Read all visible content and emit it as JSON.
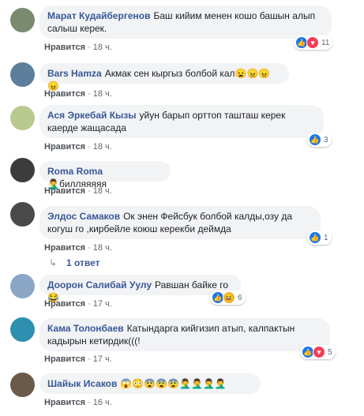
{
  "like_label": "Нравится",
  "dot": "·",
  "comments": [
    {
      "author": "Марат Кудайбергенов",
      "text": "Баш кийим менен кошо башын алып салыш керек.",
      "time": "18 ч.",
      "reactions": {
        "icons": [
          "like-icon",
          "love-icon"
        ],
        "count": "11"
      },
      "avatar_color": "#7a8a6e"
    },
    {
      "author": "Bars Hamza",
      "text": "Акмак сен кыргыз болбой кал😦😠😠😠",
      "time": "18 ч.",
      "avatar_color": "#5d7f9c"
    },
    {
      "author": "Ася Эркебай Кызы",
      "text": "уйун барып орттоп ташташ керек каерде жащасада",
      "time": "18 ч.",
      "reactions": {
        "icons": [
          "like-icon"
        ],
        "count": "3"
      },
      "avatar_color": "#b9c98f"
    },
    {
      "author": "Roma Roma",
      "text": "🤦‍♂️билляяяяя",
      "time": "18 ч.",
      "avatar_color": "#3c3c3c"
    },
    {
      "author": "Элдос Самаков",
      "text": "Ок энен Фейсбук болбой калды,озу да когуш го ,кирбейле коюш керекби деймда",
      "time": "18 ч.",
      "reactions": {
        "icons": [
          "like-icon"
        ],
        "count": "1"
      },
      "avatar_color": "#4a4a4a"
    },
    {
      "author": "Доорон Салибай Уулу",
      "text": "Равшан байке го😂",
      "time": "17 ч.",
      "reactions": {
        "icons": [
          "like-icon",
          "haha-icon"
        ],
        "count": "6"
      },
      "avatar_color": "#8aa6c4"
    },
    {
      "author": "Кама Толонбаев",
      "text": "Катындарга кийгизип атып, калпактын кадырын кетирдик(((!",
      "time": "17 ч.",
      "reactions": {
        "icons": [
          "like-icon",
          "love-icon"
        ],
        "count": "5"
      },
      "avatar_color": "#2f8fb0"
    },
    {
      "author": "Шайык Исаков",
      "text": "😱😳😨😨😨🤦‍♂️🤦‍♂️🤦‍♂️🤦‍♂️",
      "time": "16 ч.",
      "avatar_color": "#6b5a48"
    }
  ],
  "replies_link": "1 ответ"
}
